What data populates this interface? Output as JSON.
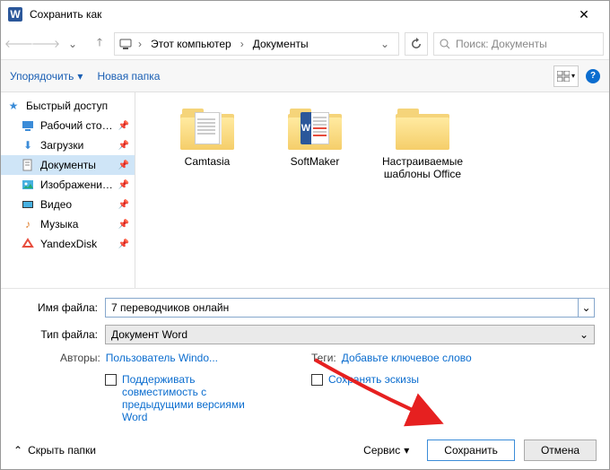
{
  "title": "Сохранить как",
  "breadcrumb": {
    "pc": "Этот компьютер",
    "docs": "Документы"
  },
  "search_placeholder": "Поиск: Документы",
  "toolbar": {
    "organize": "Упорядочить",
    "new_folder": "Новая папка"
  },
  "sidebar": {
    "quick": "Быстрый доступ",
    "desktop": "Рабочий сто…",
    "downloads": "Загрузки",
    "documents": "Документы",
    "pictures": "Изображени…",
    "video": "Видео",
    "music": "Музыка",
    "yandex": "YandexDisk"
  },
  "files": {
    "f1": "Camtasia",
    "f2": "SoftMaker",
    "f3": "Настраиваемые шаблоны Office"
  },
  "form": {
    "filename_label": "Имя файла:",
    "filename_value": "7 переводчиков онлайн",
    "filetype_label": "Тип файла:",
    "filetype_value": "Документ Word",
    "authors_label": "Авторы:",
    "authors_value": "Пользователь Windo...",
    "tags_label": "Теги:",
    "tags_value": "Добавьте ключевое слово",
    "compat": "Поддерживать совместимость с предыдущими версиями Word",
    "thumbs": "Сохранять эскизы"
  },
  "footer": {
    "hide": "Скрыть папки",
    "service": "Сервис",
    "save": "Сохранить",
    "cancel": "Отмена"
  }
}
